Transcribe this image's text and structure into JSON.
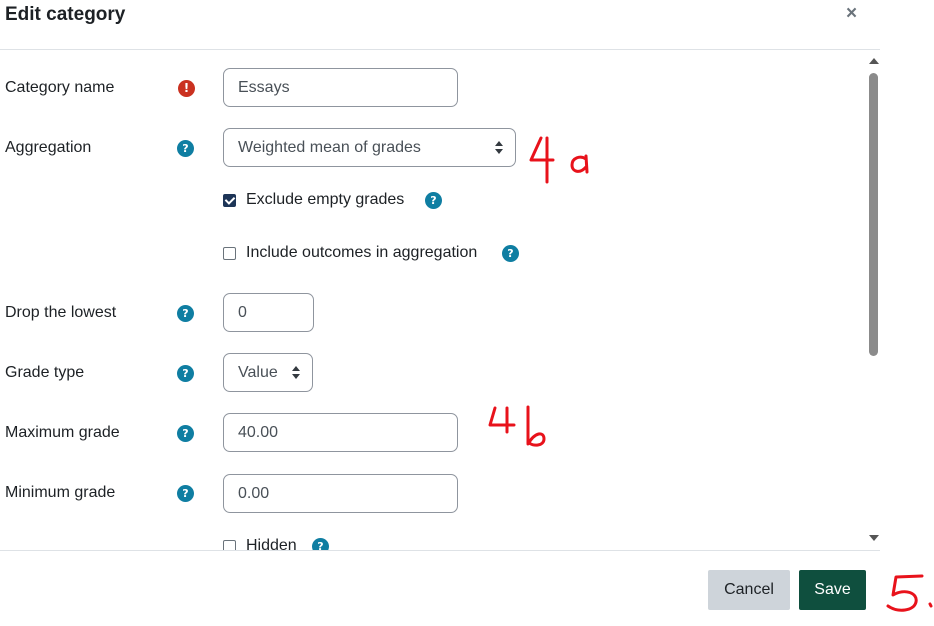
{
  "dialog": {
    "title": "Edit category",
    "close_label": "×"
  },
  "form": {
    "category_name": {
      "label": "Category name",
      "value": "Essays",
      "required_icon": "!"
    },
    "aggregation": {
      "label": "Aggregation",
      "selected": "Weighted mean of grades",
      "help_icon": "?"
    },
    "exclude_empty": {
      "label": "Exclude empty grades",
      "checked": true,
      "help_icon": "?"
    },
    "include_outcomes": {
      "label": "Include outcomes in aggregation",
      "checked": false,
      "help_icon": "?"
    },
    "drop_lowest": {
      "label": "Drop the lowest",
      "value": "0",
      "help_icon": "?"
    },
    "grade_type": {
      "label": "Grade type",
      "selected": "Value",
      "help_icon": "?"
    },
    "maximum_grade": {
      "label": "Maximum grade",
      "value": "40.00",
      "help_icon": "?"
    },
    "minimum_grade": {
      "label": "Minimum grade",
      "value": "0.00",
      "help_icon": "?"
    },
    "hidden": {
      "label": "Hidden",
      "checked": false,
      "help_icon": "?"
    }
  },
  "footer": {
    "cancel_label": "Cancel",
    "save_label": "Save"
  },
  "colors": {
    "help": "#0f7ea2",
    "required": "#ca3120",
    "save": "#0f4f3e",
    "cancel": "#ced4da",
    "annotation": "#e8121b"
  }
}
